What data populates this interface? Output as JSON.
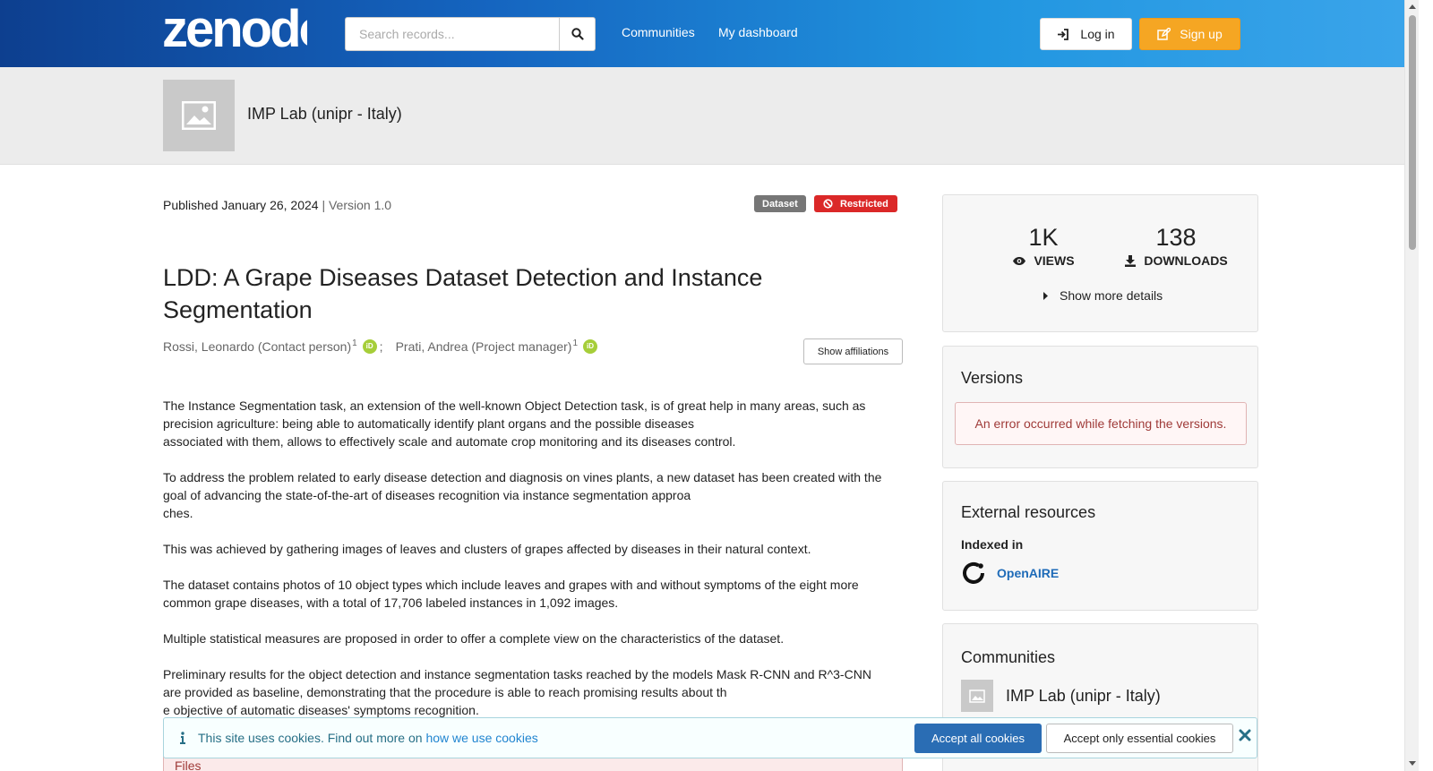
{
  "header": {
    "logo_text": "zenodo",
    "search_placeholder": "Search records...",
    "nav": [
      "Communities",
      "My dashboard"
    ],
    "login_label": "Log in",
    "signup_label": "Sign up"
  },
  "community_header": {
    "title": "IMP Lab (unipr - Italy)"
  },
  "record": {
    "published": "Published January 26, 2024",
    "version": "| Version 1.0",
    "badge_type": "Dataset",
    "badge_access": "Restricted",
    "title": "LDD: A Grape Diseases Dataset Detection and Instance Segmentation",
    "authors": [
      {
        "name": "Rossi, Leonardo (Contact person)",
        "sup": "1"
      },
      {
        "name": "Prati, Andrea (Project manager)",
        "sup": "1"
      }
    ],
    "author_separator": ";",
    "show_affiliations": "Show affiliations",
    "description": [
      "The Instance Segmentation task, an extension of the well-known Object Detection task, is of great help in many areas, such as precision agriculture: being able to automatically identify plant organs and the possible diseases\nassociated with them, allows to effectively scale and automate crop monitoring and its diseases control.",
      "To address the problem related to early disease detection and diagnosis on vines plants, a new dataset has been created with the goal of advancing the state-of-the-art of diseases recognition via instance segmentation approa\nches.",
      "This was achieved by gathering images of leaves and clusters of grapes affected by diseases in their natural context.",
      "The dataset contains photos of 10 object types which include leaves and grapes with and without symptoms of the eight more common grape diseases, with a total of 17,706 labeled instances in 1,092 images.",
      "Multiple statistical measures are proposed in order to offer a complete view on the characteristics of the dataset.",
      "Preliminary results for the object detection and instance segmentation tasks reached by the models Mask R-CNN and R^3-CNN are provided as baseline, demonstrating that the procedure is able to reach promising results about th\ne objective of automatic diseases' symptoms recognition."
    ],
    "files_label": "Files"
  },
  "sidebar": {
    "views_value": "1K",
    "views_label": "VIEWS",
    "downloads_value": "138",
    "downloads_label": "DOWNLOADS",
    "more_details": "Show more details",
    "versions_title": "Versions",
    "versions_error": "An error occurred while fetching the versions.",
    "external_title": "External resources",
    "indexed_in": "Indexed in",
    "openaire": "OpenAIRE",
    "communities_title": "Communities",
    "community_name": "IMP Lab (unipr - Italy)"
  },
  "cookie": {
    "text": "This site uses cookies. Find out more on",
    "link": "how we use cookies",
    "accept_all": "Accept all cookies",
    "accept_essential": "Accept only essential cookies"
  },
  "colors": {
    "accent_orange": "#f5a623",
    "restricted_red": "#db2828",
    "link_blue": "#1e6bb8"
  }
}
